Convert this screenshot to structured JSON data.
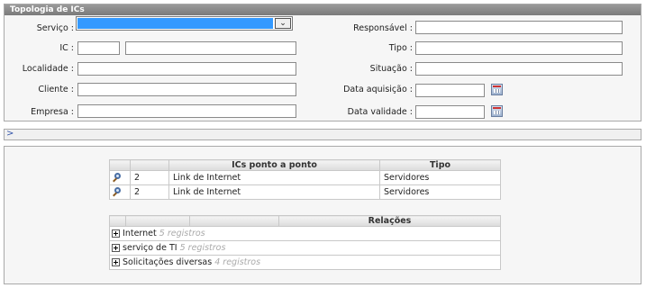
{
  "form": {
    "title": "Topologia de ICs",
    "servico_label": "Serviço :",
    "servico_value": "",
    "ic_label": "IC :",
    "ic_code": "",
    "ic_name": "",
    "localidade_label": "Localidade :",
    "localidade_value": "",
    "cliente_label": "Cliente :",
    "cliente_value": "",
    "empresa_label": "Empresa :",
    "empresa_value": "",
    "responsavel_label": "Responsável :",
    "responsavel_value": "",
    "tipo_label": "Tipo :",
    "tipo_value": "",
    "situacao_label": "Situação :",
    "situacao_value": "",
    "data_aquisicao_label": "Data aquisição :",
    "data_aquisicao_value": "",
    "data_validade_label": "Data validade :",
    "data_validade_value": ""
  },
  "toggle_bar": {
    "arrow": ">"
  },
  "ic_table": {
    "headers": [
      "ICs ponto a ponto",
      "Tipo"
    ],
    "rows": [
      {
        "id": "2",
        "name": "Link de Internet",
        "tipo": "Servidores"
      },
      {
        "id": "2",
        "name": "Link de Internet",
        "tipo": "Servidores"
      }
    ]
  },
  "rel_table": {
    "header": "Relações",
    "rows": [
      {
        "name": "Internet",
        "count": "5 registros"
      },
      {
        "name": "serviço de TI",
        "count": "5 registros"
      },
      {
        "name": "Solicitações diversas",
        "count": "4 registros"
      }
    ]
  },
  "colors": {
    "title_bar": "#8a8a8a",
    "selection": "#3399ff",
    "link": "#3355aa"
  },
  "icons": [
    "chevron-down-icon",
    "calendar-icon",
    "magnifier-icon",
    "expand-plus-icon"
  ]
}
